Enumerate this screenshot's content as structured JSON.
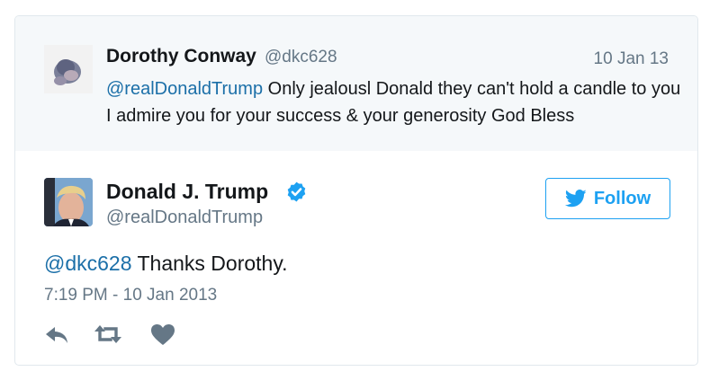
{
  "quoted_tweet": {
    "author_name": "Dorothy Conway",
    "author_handle": "@dkc628",
    "date": "10 Jan 13",
    "mention": "@realDonaldTrump",
    "text": " Only jealousl Donald they can't hold a candle to you I admire you for your success & your generosity God Bless"
  },
  "tweet": {
    "author_name": "Donald J. Trump",
    "author_handle": "@realDonaldTrump",
    "verified": true,
    "follow_label": "Follow",
    "mention": "@dkc628",
    "text": " Thanks Dorothy.",
    "timestamp": "7:19 PM - 10 Jan 2013"
  },
  "actions": [
    "reply-icon",
    "retweet-icon",
    "like-icon"
  ],
  "colors": {
    "link": "#1b6fa8",
    "accent": "#1da1f2",
    "muted": "#657786",
    "quoted_bg": "#f5f8fa",
    "icon": "#657786"
  }
}
